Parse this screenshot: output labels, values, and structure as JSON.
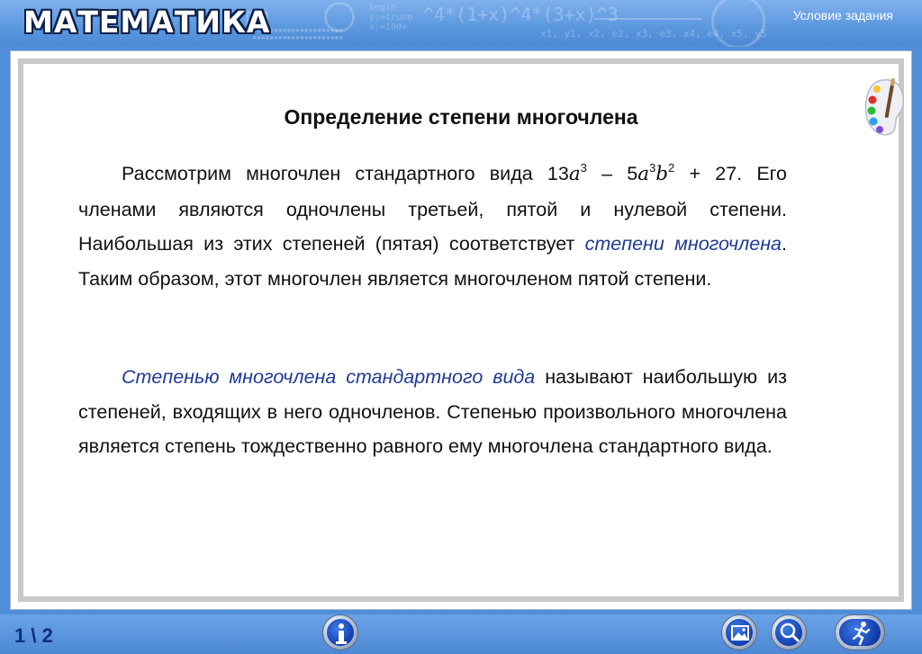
{
  "header": {
    "app_title": "МАТЕМАТИКА",
    "task_link": "Условие задания"
  },
  "content": {
    "title": "Определение степени многочлена",
    "paragraph1": {
      "before_formula": "Рассмотрим многочлен стандартного вида ",
      "formula": {
        "coef1": "13",
        "var1": "a",
        "exp1": "3",
        "minus": " – 5",
        "var2": "a",
        "exp2": "3",
        "var3": "b",
        "exp3": "2",
        "tail": " + 27"
      },
      "after_formula": ". Его членами являются одночлены третьей, пятой и нулевой степени. Наибольшая из этих степеней (пятая) соответствует ",
      "term": "степени многочлена",
      "ending": ". Таким образом, этот многочлен является многочленом пятой степени."
    },
    "paragraph2": {
      "term": "Степенью многочлена стандартного вида",
      "text": " называют наибольшую из степеней, входящих в него одночленов. Степенью произвольного многочлена является степень тождественно равного ему многочлена стандартного вида."
    }
  },
  "footer": {
    "page_counter": "1 \\ 2"
  },
  "colors": {
    "header_blue": "#5b97de",
    "footer_blue": "#4d88d4",
    "term_blue": "#1f3a93",
    "counter_blue": "#0e2c8a",
    "panel_border": "#c9c9c9"
  },
  "icons": {
    "palette": "palette-icon",
    "info": "info-icon",
    "image": "image-icon",
    "zoom": "magnifier-icon",
    "exit": "running-man-icon"
  }
}
